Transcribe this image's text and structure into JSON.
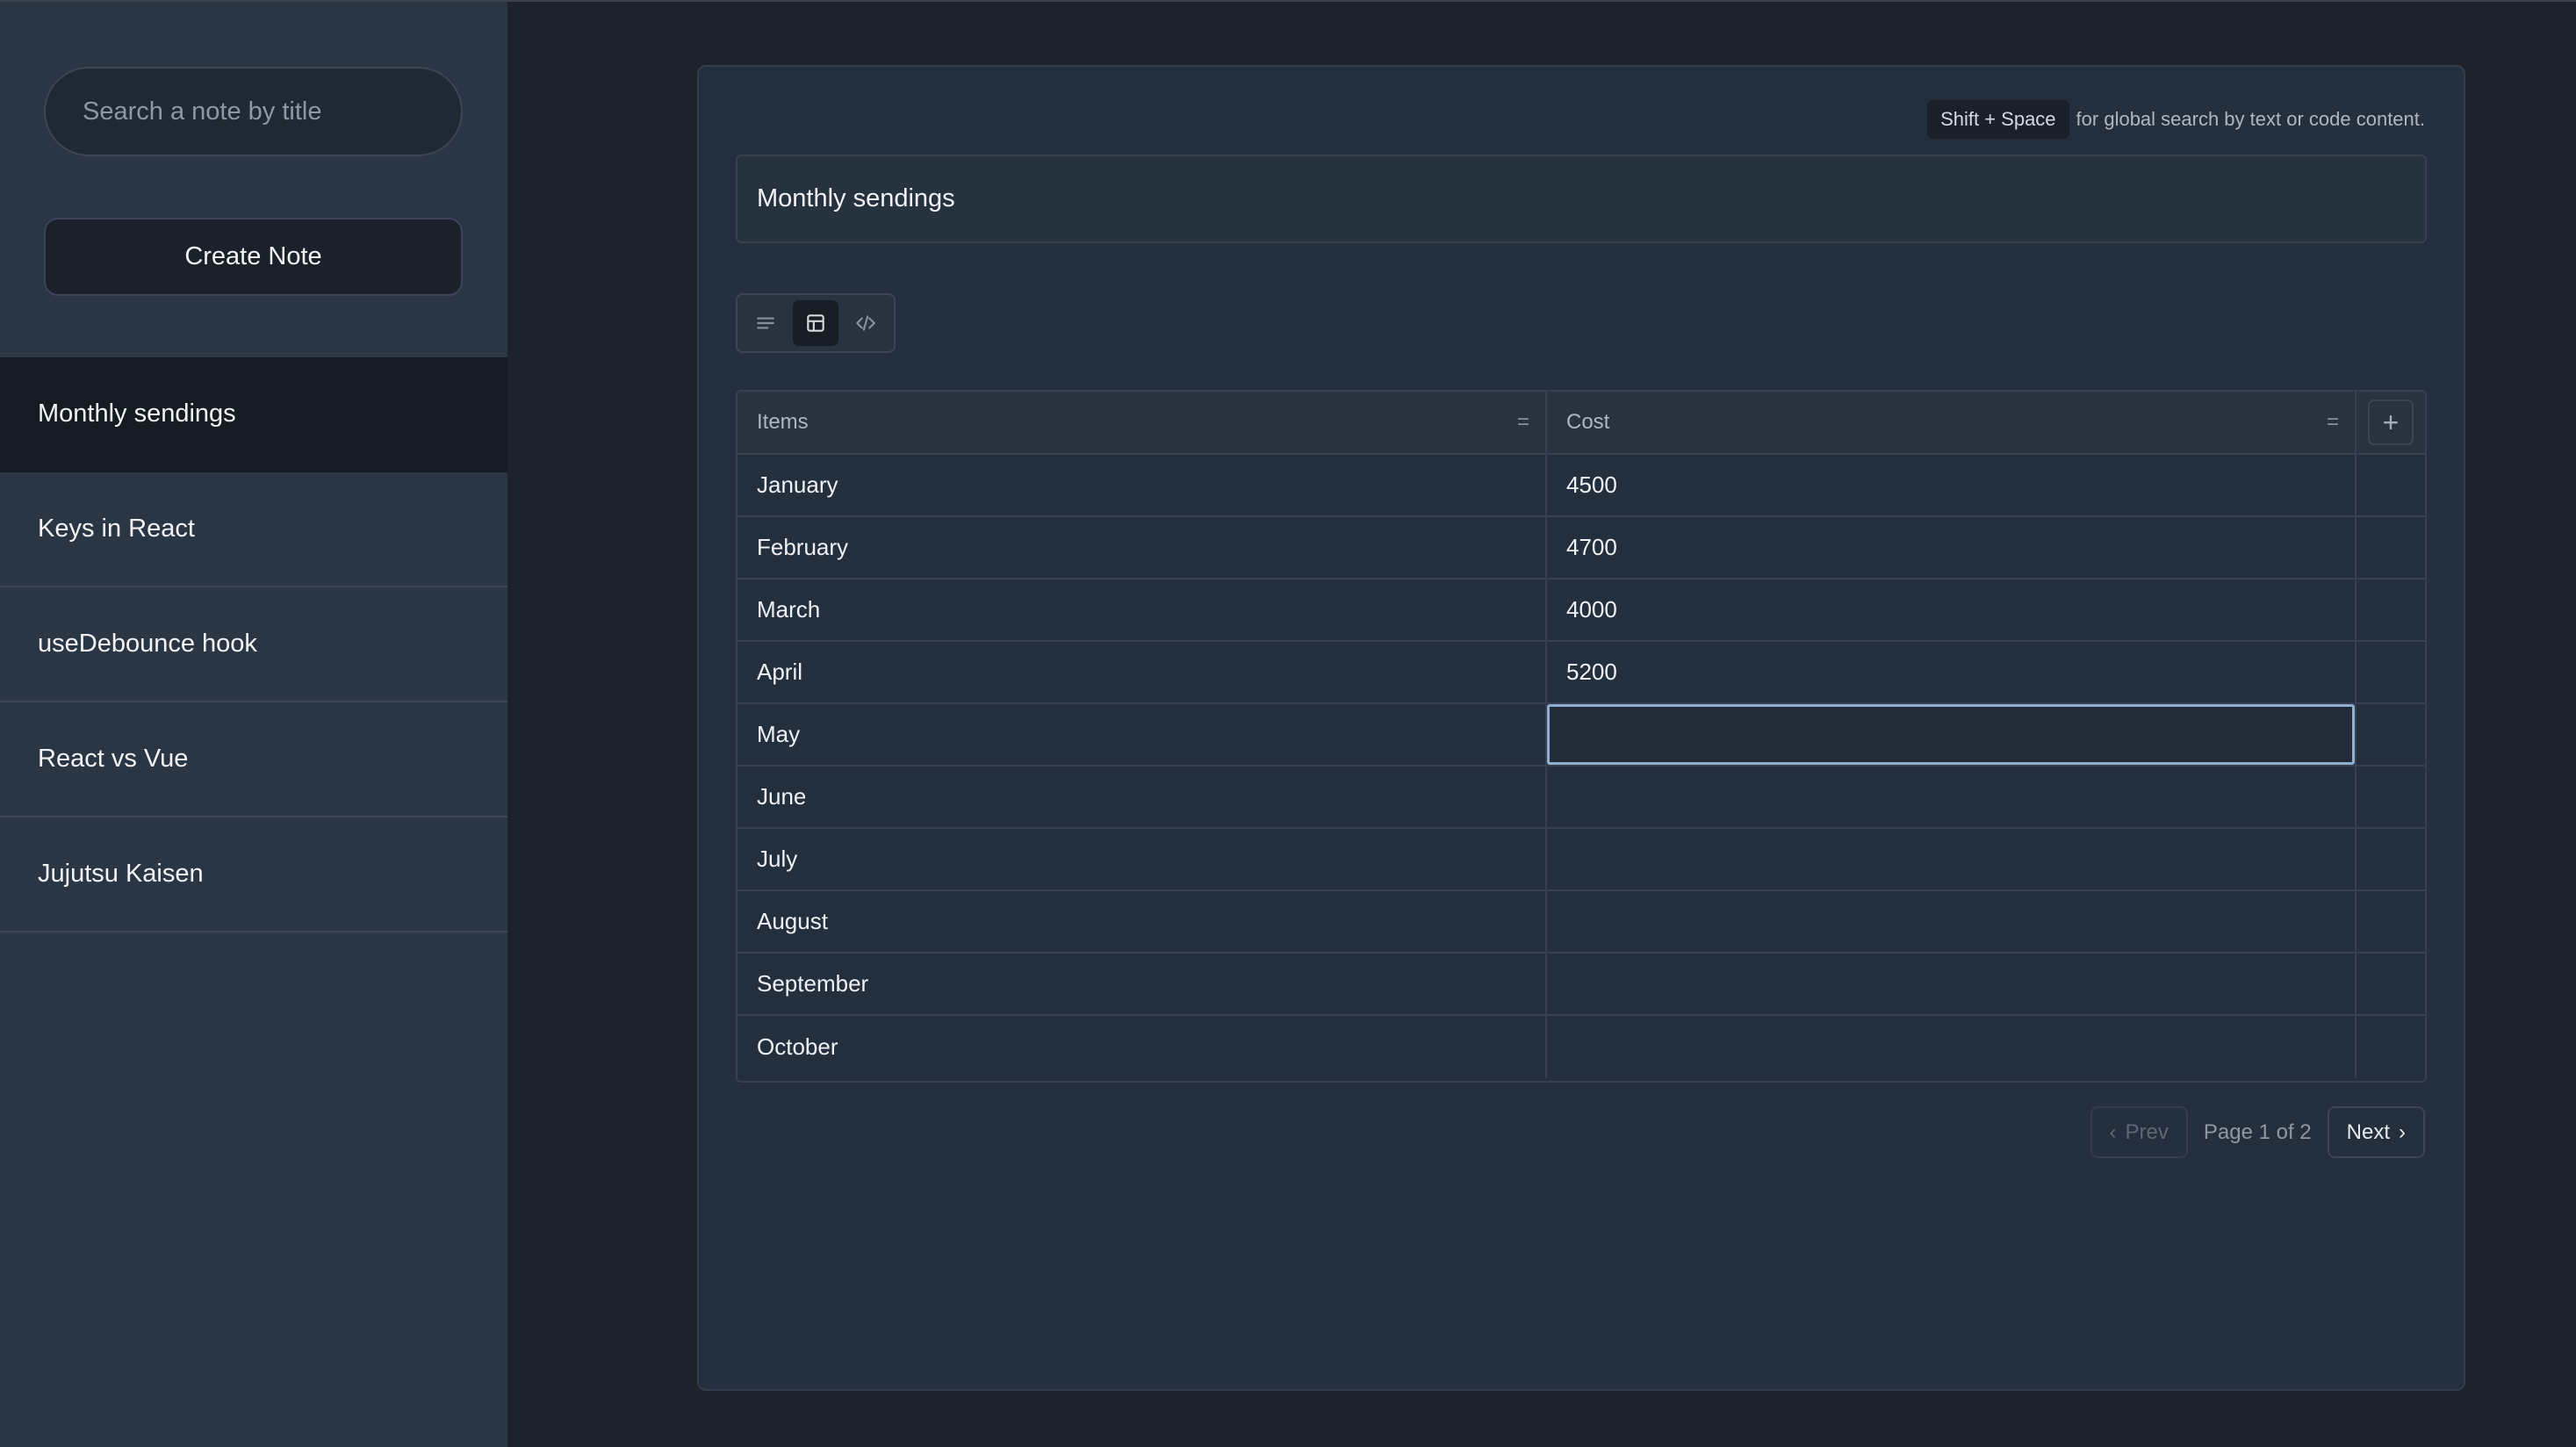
{
  "sidebar": {
    "search_placeholder": "Search a note by title",
    "create_label": "Create Note",
    "notes": [
      {
        "title": "Monthly sendings",
        "active": true
      },
      {
        "title": "Keys in React",
        "active": false
      },
      {
        "title": "useDebounce hook",
        "active": false
      },
      {
        "title": "React vs Vue",
        "active": false
      },
      {
        "title": "Jujutsu Kaisen",
        "active": false
      }
    ]
  },
  "editor": {
    "shortcut_key": "Shift + Space",
    "shortcut_hint": "for global search by text or code content.",
    "note_title": "Monthly sendings",
    "modes": [
      "text-mode",
      "table-mode",
      "code-mode"
    ],
    "active_mode": "table-mode"
  },
  "table": {
    "columns": [
      "Items",
      "Cost"
    ],
    "rows": [
      [
        "January",
        "4500"
      ],
      [
        "February",
        "4700"
      ],
      [
        "March",
        "4000"
      ],
      [
        "April",
        "5200"
      ],
      [
        "May",
        ""
      ],
      [
        "June",
        ""
      ],
      [
        "July",
        ""
      ],
      [
        "August",
        ""
      ],
      [
        "September",
        ""
      ],
      [
        "October",
        ""
      ]
    ],
    "editing_row": 4
  },
  "pagination": {
    "prev_label": "Prev",
    "next_label": "Next",
    "page_info": "Page 1 of 2"
  },
  "colors": {
    "sidebar_bg": "#2b3645",
    "panel_bg": "#242f3d",
    "active_note_bg": "#151b23",
    "focus_border": "#8fb0cc"
  }
}
